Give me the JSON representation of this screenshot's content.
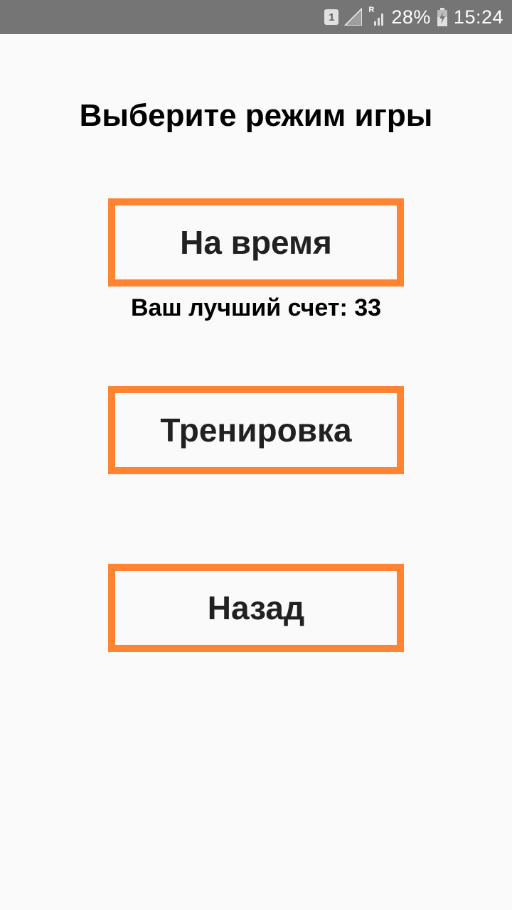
{
  "status_bar": {
    "sim_slot": "1",
    "network_label": "R",
    "battery_percent": "28%",
    "time": "15:24"
  },
  "screen": {
    "title": "Выберите режим игры",
    "buttons": {
      "timed": "На время",
      "training": "Тренировка",
      "back": "Назад"
    },
    "best_score_label": "Ваш лучший счет: 33"
  },
  "colors": {
    "accent_border": "#ff8330",
    "status_bar": "#757575",
    "background": "#fafafa"
  },
  "icons": [
    "sim-icon",
    "no-signal-icon",
    "signal-icon",
    "battery-charging-icon"
  ]
}
